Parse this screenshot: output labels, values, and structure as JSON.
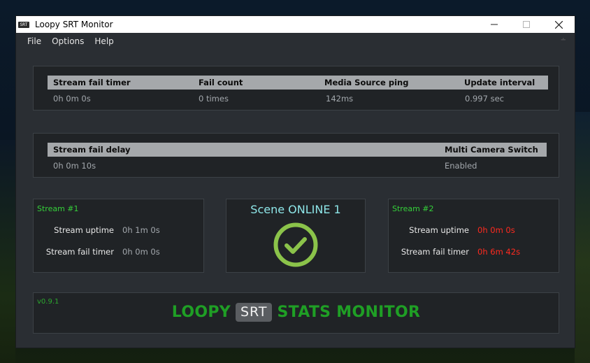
{
  "window": {
    "title": "Loopy SRT Monitor",
    "app_icon_text": "SRT"
  },
  "menu": [
    "File",
    "Options",
    "Help"
  ],
  "stats_table_1": {
    "headers": [
      "Stream fail timer",
      "Fail count",
      "Media Source ping",
      "Update interval"
    ],
    "values": [
      "0h 0m 0s",
      "0 times",
      "142ms",
      "0.997 sec"
    ]
  },
  "stats_table_2": {
    "headers": [
      "Stream fail delay",
      "Multi Camera Switch"
    ],
    "values": [
      "0h 0m 10s",
      "Enabled"
    ]
  },
  "stream1": {
    "title": "Stream #1",
    "uptime_label": "Stream uptime",
    "uptime_value": "0h 1m 0s",
    "fail_label": "Stream fail timer",
    "fail_value": "0h 0m 0s"
  },
  "scene": {
    "title": "Scene ONLINE 1",
    "status_icon": "check-circle-icon"
  },
  "stream2": {
    "title": "Stream #2",
    "uptime_label": "Stream uptime",
    "uptime_value": "0h 0m 0s",
    "fail_label": "Stream fail timer",
    "fail_value": "0h 6m 42s"
  },
  "footer": {
    "version": "v0.9.1",
    "brand_left": "LOOPY",
    "brand_badge": "SRT",
    "brand_right": "STATS MONITOR"
  },
  "colors": {
    "accent_green": "#1f9f25",
    "check_green": "#8bc34a",
    "error_red": "#ff2a1f",
    "scene_cyan": "#8ee6e8"
  }
}
